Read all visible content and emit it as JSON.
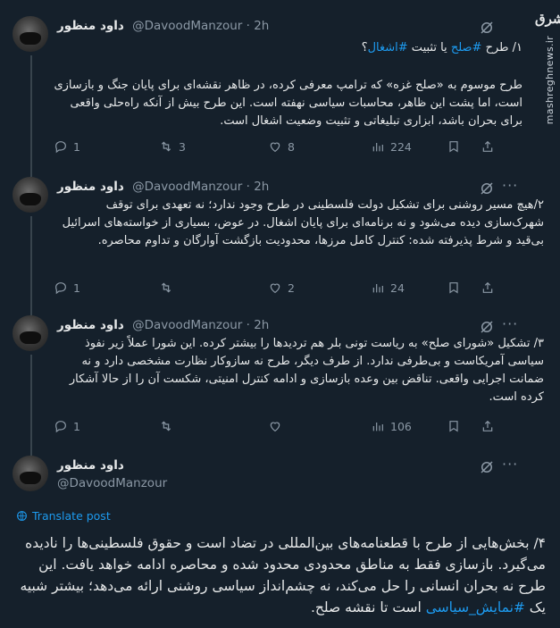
{
  "watermark": {
    "site": "mashreghnews.ir",
    "logo": "مشرق"
  },
  "tweets": [
    {
      "name": "داود منظور",
      "handle": "@DavoodManzour",
      "time": "2h",
      "title_prefix": "۱/ طرح ",
      "title_tag1": "#صلح",
      "title_mid": " یا تثبیت ",
      "title_tag2": "#اشغال",
      "title_suffix": "؟",
      "text": "طرح موسوم به «صلح غزه» که ترامپ معرفی کرده، در ظاهر نقشه‌ای برای پایان جنگ و بازسازی است، اما پشت این ظاهر، محاسبات سیاسی نهفته است. این طرح بیش از آنکه راه‌حلی واقعی برای بحران باشد، ابزاری تبلیغاتی و تثبیت وضعیت اشغال است.",
      "replies": "1",
      "retweets": "3",
      "likes": "8",
      "views": "224"
    },
    {
      "name": "داود منظور",
      "handle": "@DavoodManzour",
      "time": "2h",
      "text": "۲/هیچ مسیر روشنی برای تشکیل دولت فلسطینی در طرح وجود ندارد؛ نه تعهدی برای توقف شهرک‌سازی دیده می‌شود و نه برنامه‌ای برای پایان اشغال. در عوض، بسیاری از خواسته‌های اسرائیل بی‌قید و شرط پذیرفته شده: کنترل کامل مرزها، محدودیت بازگشت آوارگان و تداوم محاصره.",
      "replies": "1",
      "retweets": "",
      "likes": "2",
      "views": "24"
    },
    {
      "name": "داود منظور",
      "handle": "@DavoodManzour",
      "time": "2h",
      "text": "۳/ تشکیل «شورای صلح» به ریاست تونی بلر هم تردیدها را بیشتر کرده. این شورا عملاً زیر نفوذ سیاسی آمریکاست و بی‌طرفی ندارد. از طرف دیگر، طرح نه سازوکار نظارت مشخصی دارد و نه ضمانت اجرایی واقعی. تناقض بین وعده بازسازی و ادامه کنترل امنیتی، شکست آن را از حالا آشکار کرده است.",
      "replies": "1",
      "retweets": "",
      "likes": "",
      "views": "106"
    },
    {
      "name": "داود منظور",
      "handle": "@DavoodManzour",
      "translate": "Translate post",
      "text_before": "۴/ بخش‌هایی از طرح با قطعنامه‌های بین‌المللی در تضاد است و حقوق فلسطینی‌ها را نادیده می‌گیرد. بازسازی فقط به مناطق محدودی محدود شده و محاصره ادامه خواهد یافت. این طرح نه بحران انسانی را حل می‌کند، نه چشم‌انداز سیاسی روشنی ارائه می‌دهد؛ بیشتر شبیه یک ",
      "tag": "#نمایش_سیاسی",
      "text_after": " است تا نقشه صلح."
    }
  ],
  "icons": [
    "reply-icon",
    "retweet-icon",
    "like-icon",
    "views-icon",
    "bookmark-icon",
    "share-icon",
    "grok-icon",
    "more-icon",
    "globe-icon"
  ]
}
